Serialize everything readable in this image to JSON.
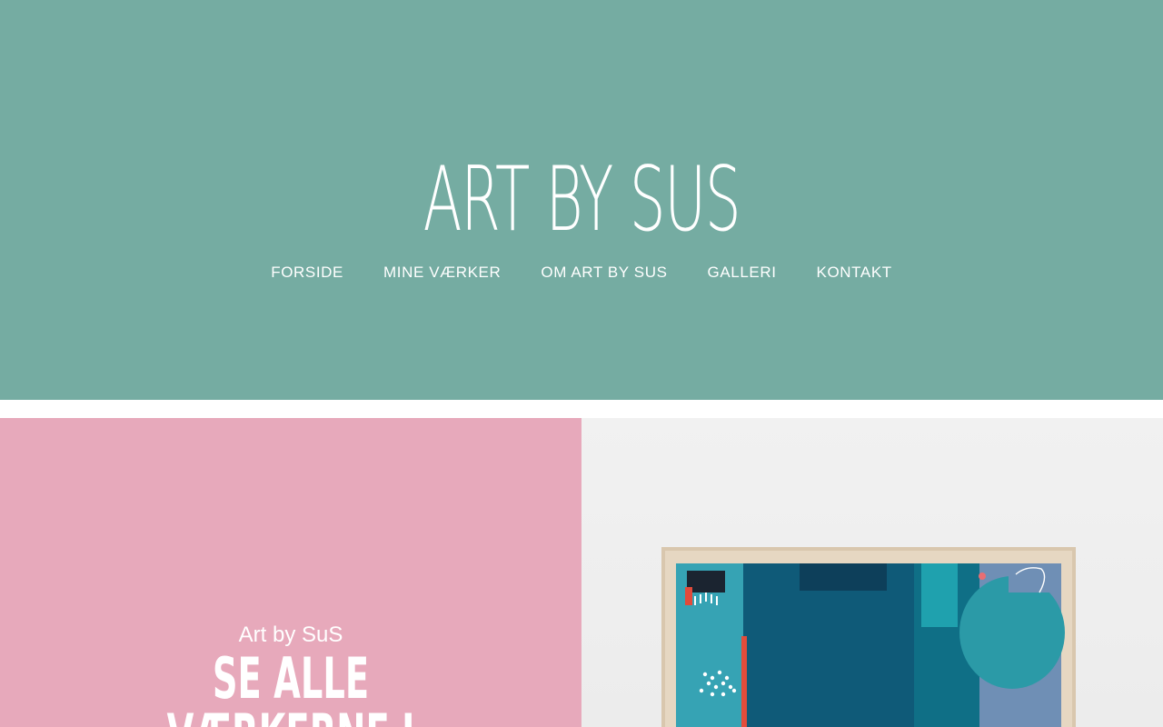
{
  "header": {
    "site_title": "ART BY SUS",
    "nav": [
      {
        "label": "FORSIDE"
      },
      {
        "label": "MINE VÆRKER"
      },
      {
        "label": "OM ART BY SUS"
      },
      {
        "label": "GALLERI"
      },
      {
        "label": "KONTAKT"
      }
    ]
  },
  "promo": {
    "kicker": "Art by SuS",
    "heading": "SE ALLE\nVÆRKERNE I"
  },
  "colors": {
    "hero_bg": "#75aca2",
    "panel_pink": "#e7a9bb",
    "text": "#ffffff"
  },
  "images": {
    "artwork": "framed-abstract-painting"
  }
}
